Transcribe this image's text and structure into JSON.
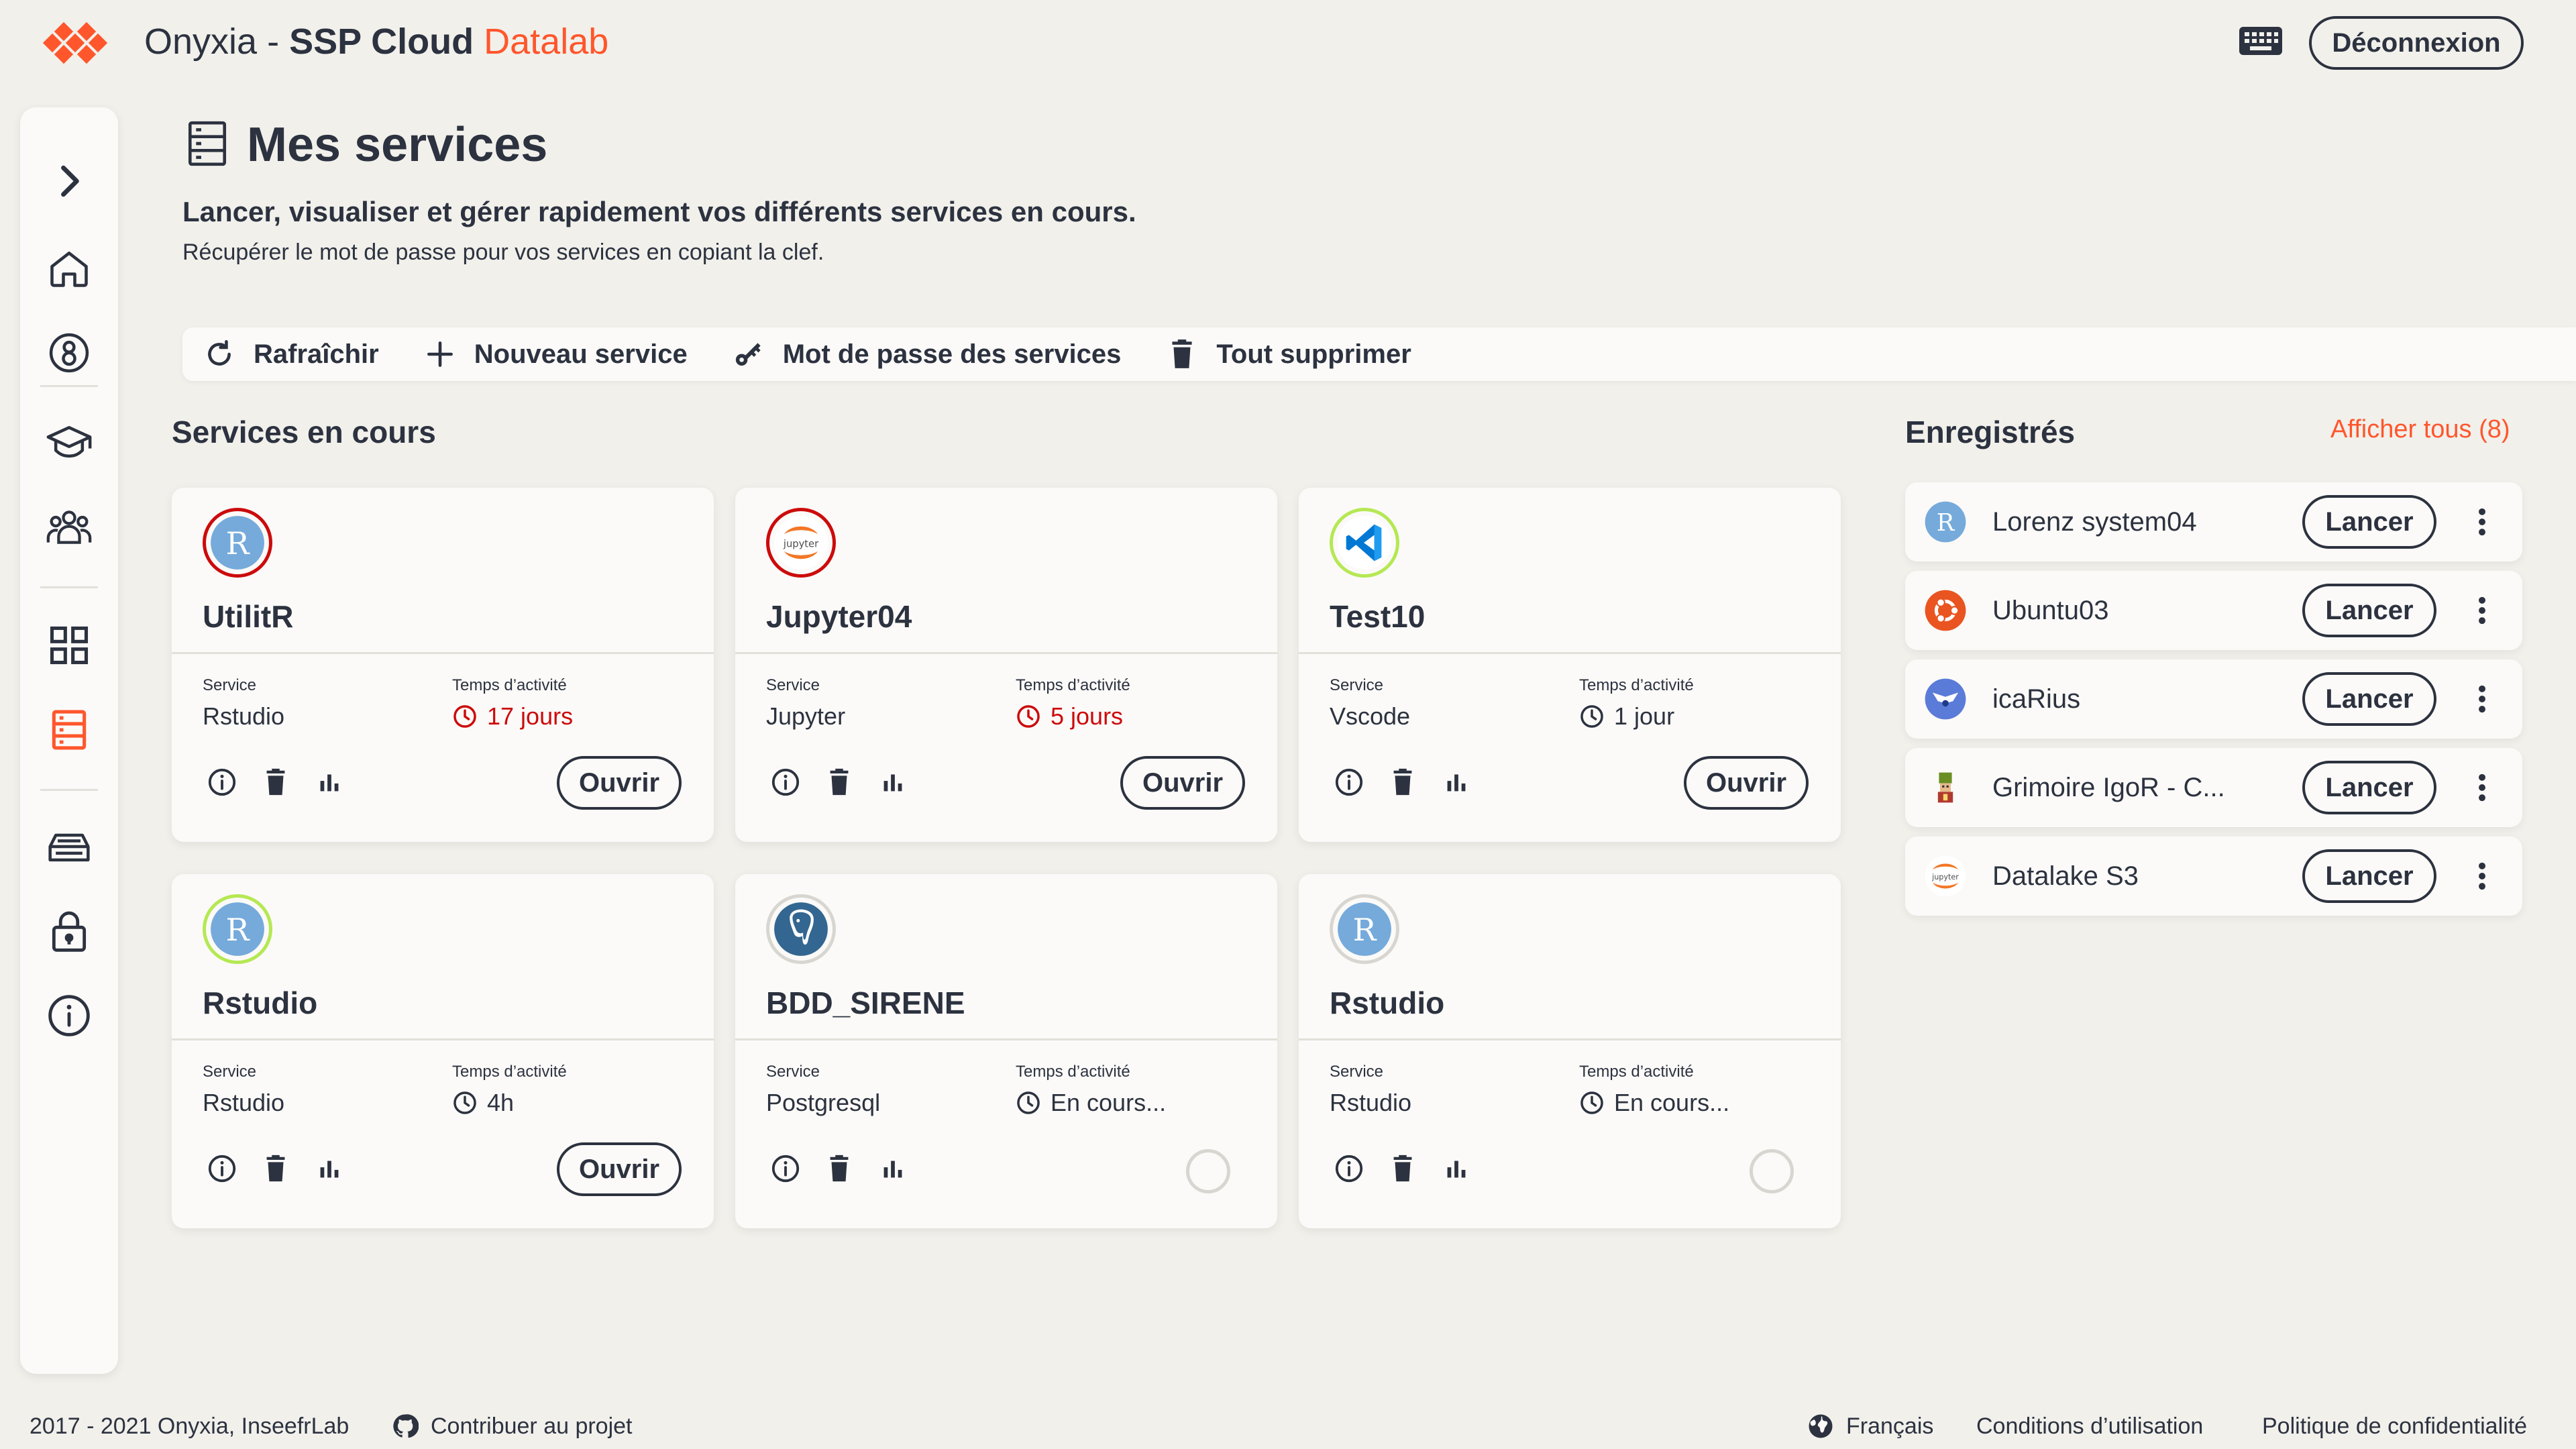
{
  "header": {
    "app_name": "Onyxia",
    "separator": " - ",
    "brand": "SSP Cloud",
    "accent": "Datalab",
    "logout_label": "Déconnexion"
  },
  "colors": {
    "accent": "#ff562c",
    "text": "#2c323f",
    "background": "#f1f0eb",
    "card": "#fbfaf8",
    "warning": "#cc0b0b"
  },
  "nav": {
    "items": [
      {
        "icon": "chevron-right-icon"
      },
      {
        "icon": "home-icon"
      },
      {
        "icon": "account-icon"
      },
      {
        "icon": "graduation-cap-icon"
      },
      {
        "icon": "community-icon"
      },
      {
        "icon": "catalog-grid-icon"
      },
      {
        "icon": "my-services-icon",
        "active": true
      },
      {
        "icon": "files-tray-icon"
      },
      {
        "icon": "lock-icon"
      },
      {
        "icon": "info-icon"
      }
    ]
  },
  "page": {
    "title": "Mes services",
    "subtitle": "Lancer, visualiser et gérer rapidement vos différents services en cours.",
    "help": "Récupérer le mot de passe pour vos services en copiant la clef."
  },
  "toolbar": {
    "refresh": "Rafraîchir",
    "new_service": "Nouveau service",
    "password": "Mot de passe des services",
    "delete_all": "Tout supprimer"
  },
  "running": {
    "title": "Services en cours",
    "service_label": "Service",
    "uptime_label": "Temps d’activité",
    "open_label": "Ouvrir",
    "cards": [
      {
        "name": "UtilitR",
        "logo": "rstudio-logo-icon",
        "service": "Rstudio",
        "uptime": "17 jours",
        "overdue": true,
        "status": "ready"
      },
      {
        "name": "Jupyter04",
        "logo": "jupyter-logo-icon",
        "service": "Jupyter",
        "uptime": "5 jours",
        "overdue": true,
        "status": "ready"
      },
      {
        "name": "Test10",
        "logo": "vscode-logo-icon",
        "service": "Vscode",
        "uptime": "1 jour",
        "overdue": false,
        "status": "ready"
      },
      {
        "name": "Rstudio",
        "logo": "rstudio-logo-icon",
        "service": "Rstudio",
        "uptime": "4h",
        "overdue": false,
        "status": "ready"
      },
      {
        "name": "BDD_SIRENE",
        "logo": "postgresql-logo-icon",
        "service": "Postgresql",
        "uptime": "En cours...",
        "overdue": false,
        "status": "starting"
      },
      {
        "name": "Rstudio",
        "logo": "rstudio-logo-icon",
        "service": "Rstudio",
        "uptime": "En cours...",
        "overdue": false,
        "status": "starting"
      }
    ]
  },
  "saved": {
    "title": "Enregistrés",
    "show_all": "Afficher tous (8)",
    "launch_label": "Lancer",
    "items": [
      {
        "name": "Lorenz system04",
        "logo": "rstudio-logo-icon"
      },
      {
        "name": "Ubuntu03",
        "logo": "ubuntu-logo-icon"
      },
      {
        "name": "icaRius",
        "logo": "icarius-logo-icon"
      },
      {
        "name": "Grimoire IgoR - C...",
        "logo": "grimoire-logo-icon"
      },
      {
        "name": "Datalake S3",
        "logo": "jupyter-logo-icon"
      }
    ]
  },
  "footer": {
    "copyright": "2017 - 2021 Onyxia, InseefrLab",
    "contribute": "Contribuer au projet",
    "language": "Français",
    "terms": "Conditions d’utilisation",
    "privacy": "Politique de confidentialité"
  }
}
